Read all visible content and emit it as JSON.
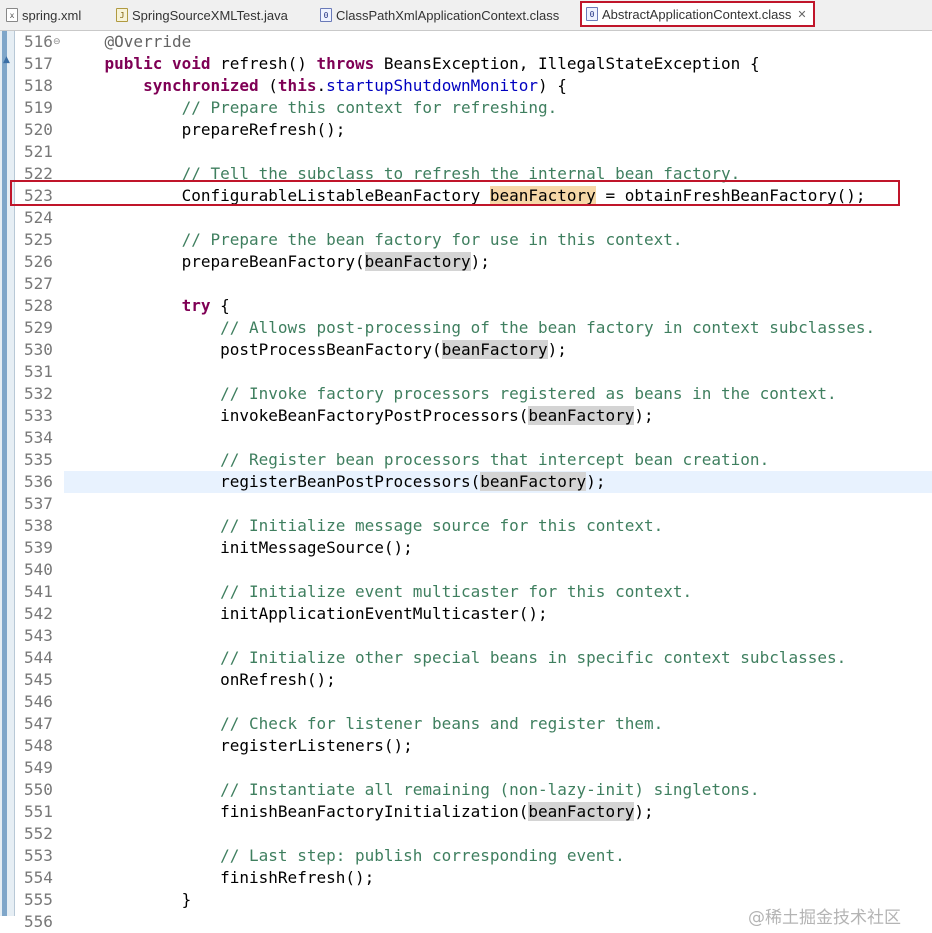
{
  "tabs": [
    {
      "label": "spring.xml",
      "icon": "xml-file-icon",
      "active": false
    },
    {
      "label": "SpringSourceXMLTest.java",
      "icon": "java-file-icon",
      "active": false
    },
    {
      "label": "ClassPathXmlApplicationContext.class",
      "icon": "class-file-icon",
      "active": false
    },
    {
      "label": "AbstractApplicationContext.class",
      "icon": "class-file-icon",
      "active": true,
      "close": "✕"
    }
  ],
  "lines": [
    {
      "num": "516",
      "fold": "⊖",
      "parts": [
        [
          "    ",
          ""
        ],
        [
          "@Override",
          "an"
        ]
      ]
    },
    {
      "num": "517",
      "parts": [
        [
          "    ",
          ""
        ],
        [
          "public",
          "kw"
        ],
        [
          " ",
          ""
        ],
        [
          "void",
          "kw"
        ],
        [
          " refresh() ",
          ""
        ],
        [
          "throws",
          "kw"
        ],
        [
          " BeansException, IllegalStateException {",
          ""
        ]
      ]
    },
    {
      "num": "518",
      "parts": [
        [
          "        ",
          ""
        ],
        [
          "synchronized",
          "kw"
        ],
        [
          " (",
          ""
        ],
        [
          "this",
          "kw"
        ],
        [
          ".",
          ""
        ],
        [
          "startupShutdownMonitor",
          "fld"
        ],
        [
          ") {",
          ""
        ]
      ]
    },
    {
      "num": "519",
      "parts": [
        [
          "            ",
          ""
        ],
        [
          "// Prepare this context for refreshing.",
          "cm"
        ]
      ]
    },
    {
      "num": "520",
      "parts": [
        [
          "            prepareRefresh();",
          ""
        ]
      ]
    },
    {
      "num": "521",
      "parts": []
    },
    {
      "num": "522",
      "parts": [
        [
          "            ",
          ""
        ],
        [
          "// Tell the subclass to refresh the internal bean factory.",
          "cm"
        ]
      ]
    },
    {
      "num": "523",
      "parts": [
        [
          "            ConfigurableListableBeanFactory ",
          ""
        ],
        [
          "beanFactory",
          "var sel"
        ],
        [
          " = obtainFreshBeanFactory();",
          ""
        ]
      ]
    },
    {
      "num": "524",
      "parts": []
    },
    {
      "num": "525",
      "parts": [
        [
          "            ",
          ""
        ],
        [
          "// Prepare the bean factory for use in this context.",
          "cm"
        ]
      ]
    },
    {
      "num": "526",
      "parts": [
        [
          "            prepareBeanFactory(",
          ""
        ],
        [
          "beanFactory",
          "var"
        ],
        [
          ");",
          ""
        ]
      ]
    },
    {
      "num": "527",
      "parts": []
    },
    {
      "num": "528",
      "parts": [
        [
          "            ",
          ""
        ],
        [
          "try",
          "kw"
        ],
        [
          " {",
          ""
        ]
      ]
    },
    {
      "num": "529",
      "parts": [
        [
          "                ",
          ""
        ],
        [
          "// Allows post-processing of the bean factory in context subclasses.",
          "cm"
        ]
      ]
    },
    {
      "num": "530",
      "parts": [
        [
          "                postProcessBeanFactory(",
          ""
        ],
        [
          "beanFactory",
          "var"
        ],
        [
          ");",
          ""
        ]
      ]
    },
    {
      "num": "531",
      "parts": []
    },
    {
      "num": "532",
      "parts": [
        [
          "                ",
          ""
        ],
        [
          "// Invoke factory processors registered as beans in the context.",
          "cm"
        ]
      ]
    },
    {
      "num": "533",
      "parts": [
        [
          "                invokeBeanFactoryPostProcessors(",
          ""
        ],
        [
          "beanFactory",
          "var"
        ],
        [
          ");",
          ""
        ]
      ]
    },
    {
      "num": "534",
      "parts": []
    },
    {
      "num": "535",
      "parts": [
        [
          "                ",
          ""
        ],
        [
          "// Register bean processors that intercept bean creation.",
          "cm"
        ]
      ]
    },
    {
      "num": "536",
      "current": true,
      "parts": [
        [
          "                registerBeanPostProcessors(",
          ""
        ],
        [
          "beanFactory",
          "var"
        ],
        [
          ");",
          ""
        ]
      ]
    },
    {
      "num": "537",
      "parts": []
    },
    {
      "num": "538",
      "parts": [
        [
          "                ",
          ""
        ],
        [
          "// Initialize message source for this context.",
          "cm"
        ]
      ]
    },
    {
      "num": "539",
      "parts": [
        [
          "                initMessageSource();",
          ""
        ]
      ]
    },
    {
      "num": "540",
      "parts": []
    },
    {
      "num": "541",
      "parts": [
        [
          "                ",
          ""
        ],
        [
          "// Initialize event multicaster for this context.",
          "cm"
        ]
      ]
    },
    {
      "num": "542",
      "parts": [
        [
          "                initApplicationEventMulticaster();",
          ""
        ]
      ]
    },
    {
      "num": "543",
      "parts": []
    },
    {
      "num": "544",
      "parts": [
        [
          "                ",
          ""
        ],
        [
          "// Initialize other special beans in specific context subclasses.",
          "cm"
        ]
      ]
    },
    {
      "num": "545",
      "parts": [
        [
          "                onRefresh();",
          ""
        ]
      ]
    },
    {
      "num": "546",
      "parts": []
    },
    {
      "num": "547",
      "parts": [
        [
          "                ",
          ""
        ],
        [
          "// Check for listener beans and register them.",
          "cm"
        ]
      ]
    },
    {
      "num": "548",
      "parts": [
        [
          "                registerListeners();",
          ""
        ]
      ]
    },
    {
      "num": "549",
      "parts": []
    },
    {
      "num": "550",
      "parts": [
        [
          "                ",
          ""
        ],
        [
          "// Instantiate all remaining (non-lazy-init) singletons.",
          "cm"
        ]
      ]
    },
    {
      "num": "551",
      "parts": [
        [
          "                finishBeanFactoryInitialization(",
          ""
        ],
        [
          "beanFactory",
          "var"
        ],
        [
          ");",
          ""
        ]
      ]
    },
    {
      "num": "552",
      "parts": []
    },
    {
      "num": "553",
      "parts": [
        [
          "                ",
          ""
        ],
        [
          "// Last step: publish corresponding event.",
          "cm"
        ]
      ]
    },
    {
      "num": "554",
      "parts": [
        [
          "                finishRefresh();",
          ""
        ]
      ]
    },
    {
      "num": "555",
      "parts": [
        [
          "            }",
          ""
        ]
      ]
    },
    {
      "num": "556",
      "parts": []
    }
  ],
  "watermark": "@稀土掘金技术社区",
  "colors": {
    "keyword": "#7f0055",
    "comment": "#3f7f5f",
    "field": "#0000c0",
    "highlight_box": "#c0152a"
  }
}
